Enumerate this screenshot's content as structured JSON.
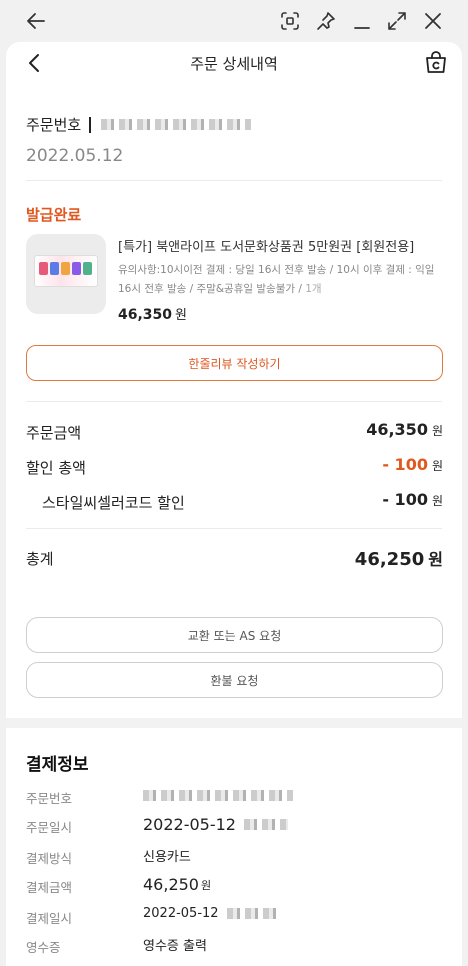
{
  "header": {
    "title": "주문 상세내역"
  },
  "order": {
    "number_label": "주문번호",
    "date": "2022.05.12"
  },
  "product": {
    "status": "발급완료",
    "name": "[특가] 북앤라이프 도서문화상품권 5만원권 [회원전용]",
    "note": "유의사항:10시이전 결제 : 당일 16시 전후 발송 / 10시 이후 결제 : 익일 16시 전후 발송 / 주말&공휴일 발송불가 /",
    "quantity": "1개",
    "price": "46,350",
    "currency": "원"
  },
  "buttons": {
    "review": "한줄리뷰 작성하기",
    "exchange": "교환 또는 AS 요청",
    "refund": "환불 요청"
  },
  "summary": {
    "order_amount_label": "주문금액",
    "order_amount": "46,350",
    "discount_total_label": "할인 총액",
    "discount_total": "- 100",
    "style_code_label": "스타일씨셀러코드 할인",
    "style_code_discount": "- 100",
    "total_label": "총계",
    "total": "46,250",
    "currency": "원"
  },
  "payment": {
    "title": "결제정보",
    "order_no_label": "주문번호",
    "order_date_label": "주문일시",
    "order_date": "2022-05-12",
    "method_label": "결제방식",
    "method": "신용카드",
    "amount_label": "결제금액",
    "amount": "46,250",
    "amount_currency": "원",
    "paid_date_label": "결제일시",
    "paid_date": "2022-05-12",
    "receipt_label": "영수증",
    "receipt": "영수증 출력"
  },
  "colors": {
    "accent": "#e0571f",
    "border": "#cfcfcf",
    "muted": "#888888"
  },
  "icons": [
    "arrow-left-icon",
    "screenshot-icon",
    "pin-icon",
    "minimize-icon",
    "expand-icon",
    "close-icon",
    "chevron-left-icon",
    "shopping-bag-icon"
  ]
}
